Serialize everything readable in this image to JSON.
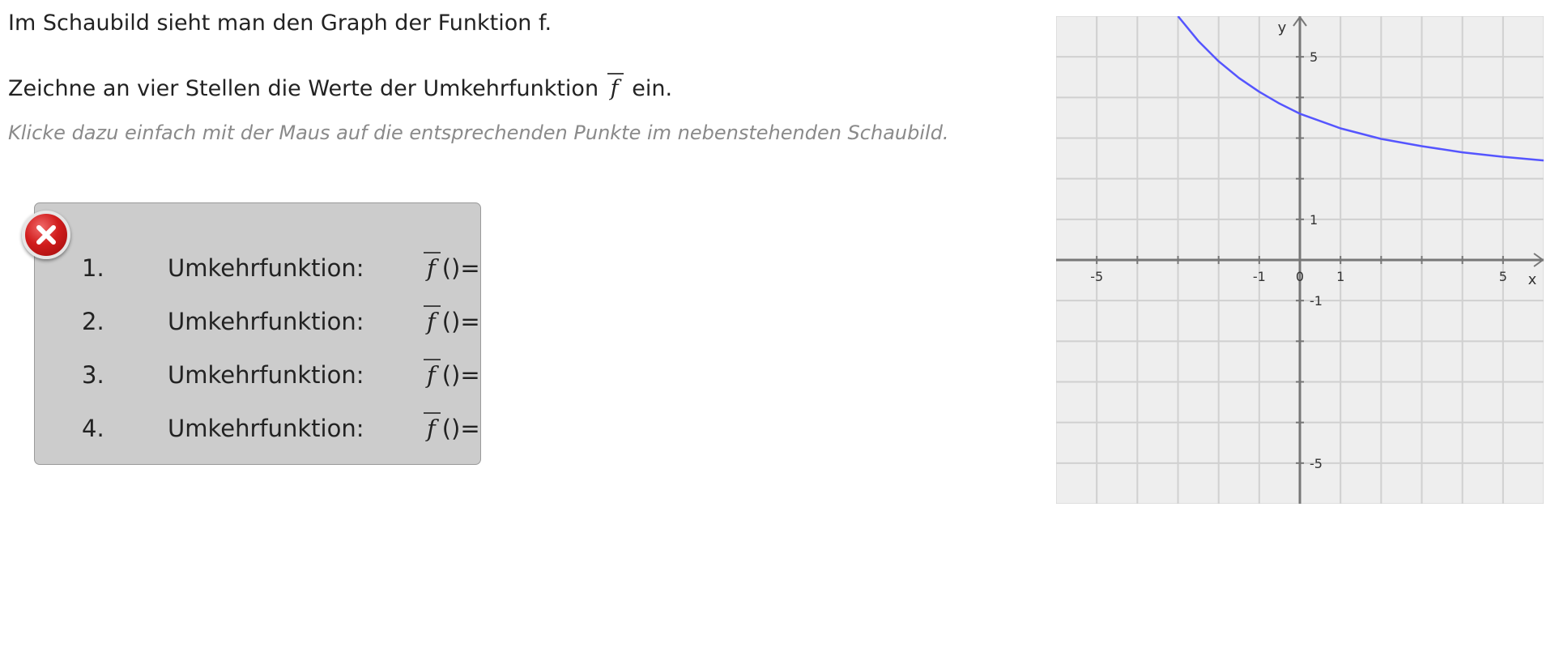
{
  "intro": "Im Schaubild sieht man den Graph der Funktion f.",
  "task": {
    "before": "Zeichne an vier Stellen die Werte der Umkehrfunktion",
    "symbol": "f",
    "after": "ein."
  },
  "hint": "Klicke dazu einfach mit der Maus auf die entsprechenden Punkte im nebenstehenden Schaubild.",
  "answers": [
    {
      "number": "1.",
      "label": "Umkehrfunktion:",
      "symbol": "f",
      "expr": "()="
    },
    {
      "number": "2.",
      "label": "Umkehrfunktion:",
      "symbol": "f",
      "expr": "()="
    },
    {
      "number": "3.",
      "label": "Umkehrfunktion:",
      "symbol": "f",
      "expr": "()="
    },
    {
      "number": "4.",
      "label": "Umkehrfunktion:",
      "symbol": "f",
      "expr": "()="
    }
  ],
  "close_icon": "close-icon",
  "colors": {
    "close_button": "#d11d1d",
    "answer_box": "#cccccc",
    "graph_background": "#eeeeee",
    "grid": "#d0d0d0",
    "axis": "#777777",
    "curve": "#5555ff"
  },
  "chart_data": {
    "type": "line",
    "xlabel": "x",
    "ylabel": "y",
    "xlim": [
      -6,
      6
    ],
    "ylim": [
      -6,
      6
    ],
    "grid": true,
    "x_ticks": [
      "-5",
      "-1",
      "0",
      "1",
      "5"
    ],
    "y_ticks": [
      "5",
      "1",
      "-1",
      "-5"
    ],
    "series": [
      {
        "x": [
          -3,
          -2.5,
          -2,
          -1.5,
          -1,
          -0.5,
          0,
          1,
          2,
          3,
          4,
          5,
          6
        ],
        "y": [
          6.0,
          5.39,
          4.89,
          4.48,
          4.14,
          3.85,
          3.6,
          3.24,
          2.98,
          2.8,
          2.65,
          2.54,
          2.45
        ]
      }
    ]
  }
}
